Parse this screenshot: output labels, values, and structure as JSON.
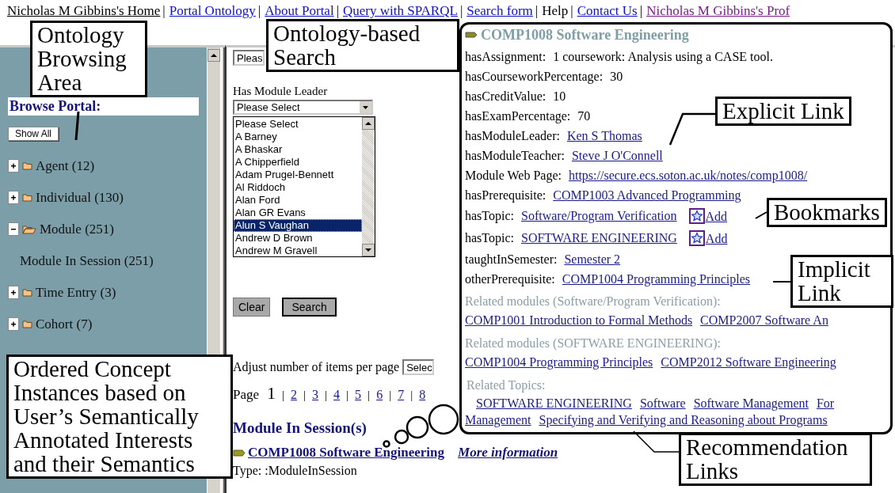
{
  "nav": {
    "separator": "|",
    "items": [
      {
        "label": "Nicholas M Gibbins's Home",
        "kind": "active"
      },
      {
        "label": "Portal Ontology",
        "kind": "link"
      },
      {
        "label": "About Portal",
        "kind": "link"
      },
      {
        "label": "Query with SPARQL",
        "kind": "link"
      },
      {
        "label": "Search form",
        "kind": "link"
      },
      {
        "label": "Help",
        "kind": "text"
      },
      {
        "label": "Contact Us",
        "kind": "link"
      },
      {
        "label": "Nicholas M Gibbins's Prof",
        "kind": "visited"
      }
    ]
  },
  "browse": {
    "title": "Browse Portal:",
    "show_all": "Show All",
    "tree": [
      {
        "label": "Agent (12)",
        "expanded": false
      },
      {
        "label": "Individual (130)",
        "expanded": false
      },
      {
        "label": "Module (251)",
        "expanded": true,
        "children": [
          {
            "label": "Module In Session (251)"
          }
        ]
      },
      {
        "label": "Time Entry (3)",
        "expanded": false
      },
      {
        "label": "Cohort (7)",
        "expanded": false
      }
    ]
  },
  "search": {
    "first_select": "Pleas",
    "leader_label": "Has Module Leader",
    "leader_select": "Please Select",
    "listbox": [
      {
        "label": "Please Select",
        "selected": false
      },
      {
        "label": "A Barney",
        "selected": false
      },
      {
        "label": "A Bhaskar",
        "selected": false
      },
      {
        "label": "A Chipperfield",
        "selected": false
      },
      {
        "label": "Adam Prugel-Bennett",
        "selected": false
      },
      {
        "label": "Al Riddoch",
        "selected": false
      },
      {
        "label": "Alan Ford",
        "selected": false
      },
      {
        "label": "Alan GR Evans",
        "selected": false
      },
      {
        "label": "Alun S Vaughan",
        "selected": true
      },
      {
        "label": "Andrew D Brown",
        "selected": false
      },
      {
        "label": "Andrew M Gravell",
        "selected": false
      }
    ],
    "buttons": [
      "Clear",
      "Search"
    ],
    "items_per_page_label": "Adjust number of items per page",
    "items_per_page_select": "Selec",
    "page_label": "Page",
    "page_separator": "|",
    "pages": [
      {
        "label": "1",
        "selected": true
      },
      {
        "label": "2",
        "selected": false
      },
      {
        "label": "3",
        "selected": false
      },
      {
        "label": "4",
        "selected": false
      },
      {
        "label": "5",
        "selected": false
      },
      {
        "label": "6",
        "selected": false
      },
      {
        "label": "7",
        "selected": false
      },
      {
        "label": "8",
        "selected": false
      }
    ],
    "results_heading": "Module In Session(s)",
    "result": {
      "title": "COMP1008 Software Engineering",
      "more": "More information",
      "type": "Type: :ModuleInSession"
    }
  },
  "detail": {
    "title": "COMP1008 Software Engineering",
    "rows": [
      {
        "label": "hasAssignment:",
        "value": "1 coursework: Analysis using a CASE tool.",
        "kind": "text"
      },
      {
        "label": "hasCourseworkPercentage:",
        "value": "30",
        "kind": "text"
      },
      {
        "label": "hasCreditValue:",
        "value": "10",
        "kind": "text"
      },
      {
        "label": "hasExamPercentage:",
        "value": "70",
        "kind": "text"
      },
      {
        "label": "hasModuleLeader:",
        "value": "Ken S Thomas",
        "kind": "link"
      },
      {
        "label": "hasModuleTeacher:",
        "value": "Steve J O'Connell",
        "kind": "link"
      },
      {
        "label": "Module Web Page:",
        "value": "https://secure.ecs.soton.ac.uk/notes/comp1008/",
        "kind": "link"
      },
      {
        "label": "hasPrerequisite:",
        "value": "COMP1003 Advanced Programming",
        "kind": "link"
      },
      {
        "label": "hasTopic:",
        "value": "Software/Program Verification",
        "kind": "bookmark",
        "bookmark": "Add"
      },
      {
        "label": "hasTopic:",
        "value": "SOFTWARE ENGINEERING",
        "kind": "bookmark",
        "bookmark": "Add"
      },
      {
        "label": "taughtInSemester:",
        "value": "Semester 2",
        "kind": "link"
      },
      {
        "label": "otherPrerequisite:",
        "value": "COMP1004 Programming Principles",
        "kind": "link"
      }
    ],
    "related": [
      {
        "heading": "Related modules (Software/Program Verification):",
        "links": [
          "COMP1001 Introduction to Formal Methods",
          "COMP2007 Software An"
        ]
      },
      {
        "heading": "Related modules (SOFTWARE ENGINEERING):",
        "links": [
          "COMP1004 Programming Principles",
          "COMP2012 Software Engineering"
        ]
      }
    ],
    "topics": {
      "heading": "Related Topics:",
      "lines": [
        [
          "SOFTWARE ENGINEERING",
          "Software",
          "Software Management",
          "For"
        ],
        [
          "Management",
          "Specifying and Verifying and Reasoning about Programs"
        ]
      ]
    }
  },
  "callouts": [
    "Ontology Browsing Area",
    "Ontology-based Search",
    "Explicit Link",
    "Bookmarks",
    "Implicit Link",
    "Ordered Concept Instances based on User’s Semantically Annotated Interests and their Semantics",
    "Recommendation Links"
  ]
}
